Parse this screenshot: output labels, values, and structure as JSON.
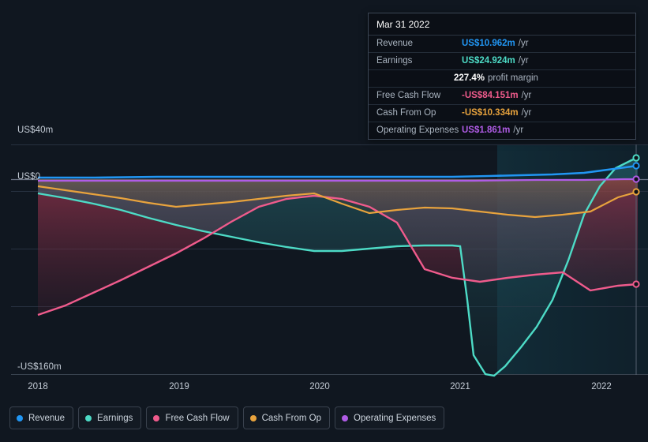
{
  "tooltip": {
    "title": "Mar 31 2022",
    "rows": [
      {
        "key": "Revenue",
        "value": "US$10.962m",
        "unit": "/yr",
        "color": "#2196f3"
      },
      {
        "key": "Earnings",
        "value": "US$24.924m",
        "unit": "/yr",
        "color": "#4ddbc6"
      },
      {
        "key": "",
        "value": "227.4%",
        "unit": "profit margin",
        "color": "#ffffff"
      },
      {
        "key": "Free Cash Flow",
        "value": "-US$84.151m",
        "unit": "/yr",
        "color": "#ef5b8c"
      },
      {
        "key": "Cash From Op",
        "value": "-US$10.334m",
        "unit": "/yr",
        "color": "#e8a33d"
      },
      {
        "key": "Operating Expenses",
        "value": "US$1.861m",
        "unit": "/yr",
        "color": "#b05ce6"
      }
    ]
  },
  "legend": [
    {
      "label": "Revenue",
      "color": "#2196f3"
    },
    {
      "label": "Earnings",
      "color": "#4ddbc6"
    },
    {
      "label": "Free Cash Flow",
      "color": "#ef5b8c"
    },
    {
      "label": "Cash From Op",
      "color": "#e8a33d"
    },
    {
      "label": "Operating Expenses",
      "color": "#b05ce6"
    }
  ],
  "axes": {
    "y_top": "US$40m",
    "y_zero": "US$0",
    "y_bottom": "-US$160m",
    "x_ticks": [
      "2018",
      "2019",
      "2020",
      "2021",
      "2022"
    ]
  },
  "chart_data": {
    "type": "line",
    "title": "",
    "xlabel": "",
    "ylabel": "US$",
    "ylim": [
      -160,
      40
    ],
    "grid": true,
    "legend_position": "bottom",
    "x_tick_labels": [
      "2018",
      "2019",
      "2020",
      "2021",
      "2022"
    ],
    "x": [
      "2018-01",
      "2018-04",
      "2018-07",
      "2018-10",
      "2019-01",
      "2019-04",
      "2019-07",
      "2019-10",
      "2020-01",
      "2020-04",
      "2020-07",
      "2020-10",
      "2021-01",
      "2021-04",
      "2021-07",
      "2021-10",
      "2022-01",
      "2022-03"
    ],
    "series": [
      {
        "name": "Revenue",
        "color": "#2196f3",
        "unit": "US$m",
        "values": [
          2.0,
          2.0,
          2.0,
          2.0,
          2.0,
          2.0,
          2.2,
          2.2,
          2.2,
          2.2,
          2.2,
          2.2,
          2.0,
          2.0,
          2.2,
          3.0,
          6.0,
          10.962
        ]
      },
      {
        "name": "Earnings",
        "color": "#4ddbc6",
        "unit": "US$m",
        "values": [
          -8.0,
          -14.0,
          -20.0,
          -26.0,
          -32.0,
          -38.0,
          -44.0,
          -50.0,
          -52.0,
          -50.0,
          -49.0,
          -48.0,
          -48.0,
          -155.0,
          -130.0,
          -100.0,
          -40.0,
          24.924
        ]
      },
      {
        "name": "Free Cash Flow",
        "color": "#ef5b8c",
        "unit": "US$m",
        "values": [
          -122.0,
          -112.0,
          -100.0,
          -88.0,
          -76.0,
          -64.0,
          -52.0,
          -38.0,
          -28.0,
          -26.0,
          -28.0,
          -34.0,
          -44.0,
          -78.0,
          -80.0,
          -76.0,
          -88.0,
          -84.151
        ]
      },
      {
        "name": "Cash From Op",
        "color": "#e8a33d",
        "unit": "US$m",
        "values": [
          -4.0,
          -8.0,
          -12.0,
          -16.0,
          -20.0,
          -22.0,
          -20.0,
          -18.0,
          -16.0,
          -22.0,
          -30.0,
          -28.0,
          -26.0,
          -28.0,
          -32.0,
          -34.0,
          -30.0,
          -10.334
        ]
      },
      {
        "name": "Operating Expenses",
        "color": "#b05ce6",
        "unit": "US$m",
        "values": [
          0.9,
          0.9,
          1.0,
          1.0,
          1.0,
          1.0,
          1.1,
          1.1,
          1.1,
          1.1,
          1.2,
          1.2,
          1.2,
          1.2,
          1.3,
          1.4,
          1.6,
          1.861
        ]
      }
    ]
  }
}
